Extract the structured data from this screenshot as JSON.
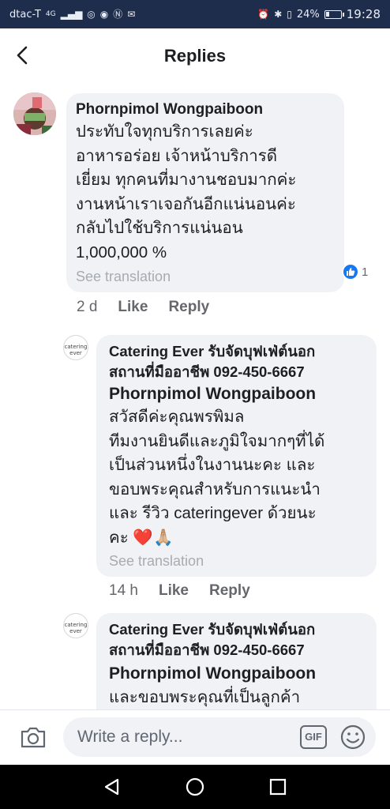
{
  "status_bar": {
    "carrier": "dtac-T",
    "network": "4G",
    "battery_percent": "24%",
    "battery_level": 0.24,
    "time": "19:28"
  },
  "header": {
    "title": "Replies",
    "back_icon": "chevron-left-icon"
  },
  "comment": {
    "author": "Phornpimol Wongpaiboon",
    "text_lines": [
      "ประทับใจทุกบริการเลยค่ะ",
      "อาหารอร่อย เจ้าหน้าบริการดี",
      "เยี่ยม ทุกคนที่มางานชอบมากค่ะ",
      "งานหน้าเราเจอกันอีกแน่นอนค่ะ",
      "กลับไปใช้บริการแน่นอน",
      "1,000,000 %"
    ],
    "see_translation": "See translation",
    "time": "2 d",
    "like_label": "Like",
    "reply_label": "Reply",
    "reaction_icon": "like-icon",
    "reaction_count": "1"
  },
  "replies": [
    {
      "avatar_text": "catering ever",
      "page_name_lines": [
        "Catering Ever รับจัดบุฟเฟ่ต์นอก",
        "สถานที่มืออาชีพ 092-450-6667"
      ],
      "mention": "Phornpimol Wongpaiboon",
      "text_lines": [
        "สวัสดีค่ะคุณพรพิมล",
        "ทีมงานยินดีและภูมิใจมากๆที่ได้",
        "เป็นส่วนหนึ่งในงานนะคะ และ",
        "ขอบพระคุณสำหรับการแนะนำ",
        "และ รีวิว cateringever ด้วยนะ",
        "คะ ❤️🙏🏼"
      ],
      "see_translation": "See translation",
      "time": "14 h",
      "like_label": "Like",
      "reply_label": "Reply"
    },
    {
      "avatar_text": "catering ever",
      "page_name_lines": [
        "Catering Ever รับจัดบุฟเฟ่ต์นอก",
        "สถานที่มืออาชีพ 092-450-6667"
      ],
      "mention": "Phornpimol Wongpaiboon",
      "text_lines": [
        "และขอบพระคุณที่เป็นลูกค้า"
      ]
    }
  ],
  "composer": {
    "placeholder": "Write a reply...",
    "camera_icon": "camera-icon",
    "gif_label": "GIF",
    "emoji_icon": "smiley-icon"
  },
  "nav": {
    "back_icon": "triangle-back-icon",
    "home_icon": "circle-home-icon",
    "recents_icon": "square-recents-icon"
  },
  "colors": {
    "status_bar_bg": "#1f2d4c",
    "bubble_bg": "#f0f2f5",
    "like_blue": "#1877f2",
    "nav_bg": "#000000"
  }
}
